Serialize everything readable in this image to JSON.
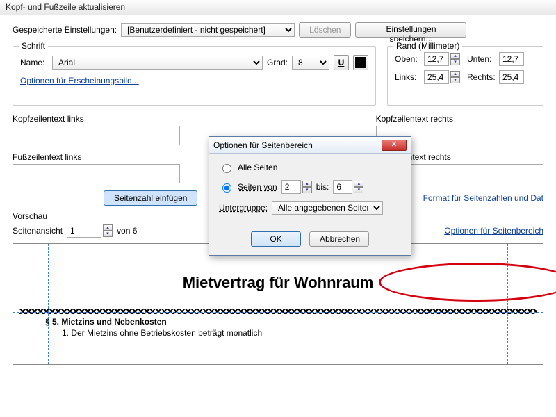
{
  "window_title": "Kopf- und Fußzeile aktualisieren",
  "labels": {
    "saved_settings": "Gespeicherte Einstellungen:",
    "delete": "Löschen",
    "save_settings": "Einstellungen speichern...",
    "saved_combo": "[Benutzerdefiniert - nicht gespeichert]",
    "font_group": "Schrift",
    "name": "Name:",
    "grad": "Grad:",
    "font_value": "Arial",
    "grad_value": "8",
    "appearance_link": "Optionen für Erscheinungsbild...",
    "margin_group": "Rand (Millimeter)",
    "top": "Oben:",
    "bottom": "Unten:",
    "left": "Links:",
    "right": "Rechts:",
    "m_top": "12,7",
    "m_bottom": "12,7",
    "m_left": "25,4",
    "m_right": "25,4",
    "hdr_left": "Kopfzeilentext links",
    "hdr_right": "Kopfzeilentext rechts",
    "ftr_left": "Fußzeilentext links",
    "ftr_right": "Fußzeilentext rechts",
    "insert_pagenum": "Seitenzahl einfügen",
    "format_link": "Format für Seitenzahlen und Dat",
    "preview": "Vorschau",
    "page_view": "Seitenansicht",
    "page_val": "1",
    "page_of": "von 6",
    "range_link": "Optionen für Seitenbereich"
  },
  "modal": {
    "title": "Optionen für Seitenbereich",
    "all_pages": "Alle Seiten",
    "pages_from": "Seiten von",
    "from_v": "2",
    "to_lbl": "bis:",
    "to_v": "6",
    "subgroup": "Untergruppe:",
    "subgroup_v": "Alle angegebenen Seiten",
    "ok": "OK",
    "cancel": "Abbrechen"
  },
  "doc": {
    "title": "Mietvertrag für Wohnraum",
    "sec_head": "§ 5.   Mietzins und Nebenkosten",
    "sec_line": "1.    Der Mietzins ohne Betriebskosten beträgt monatlich"
  }
}
